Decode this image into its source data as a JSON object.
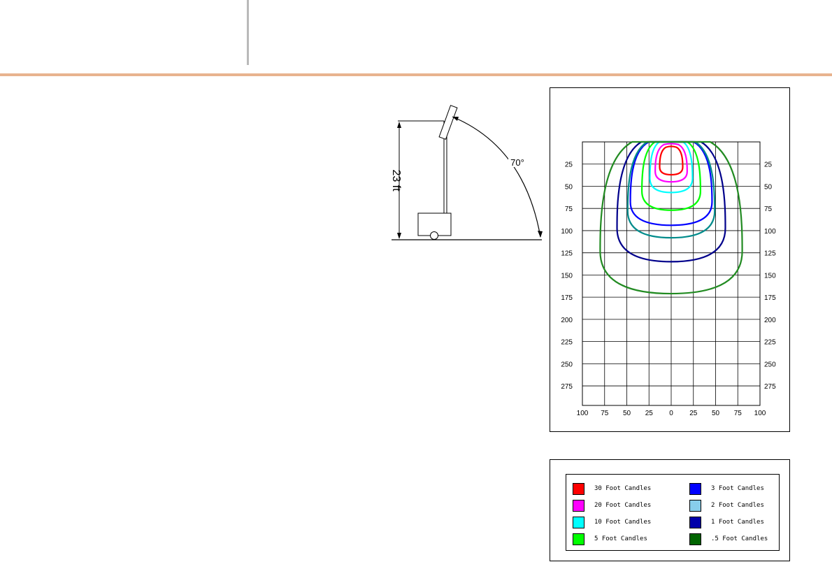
{
  "diagram": {
    "height_label": "23 ft",
    "angle_label": "70°"
  },
  "chart_data": {
    "type": "contour",
    "x_ticks": [
      "100",
      "75",
      "50",
      "25",
      "0",
      "25",
      "50",
      "75",
      "100"
    ],
    "y_ticks": [
      "25",
      "50",
      "75",
      "100",
      "125",
      "150",
      "175",
      "200",
      "225",
      "250",
      "275"
    ],
    "contours": [
      {
        "name": "30 Foot Candles",
        "color": "#ff0000",
        "near": 6,
        "far": 37,
        "half_width": 13
      },
      {
        "name": "20 Foot Candles",
        "color": "#ff00ff",
        "near": 3,
        "far": 45,
        "half_width": 18
      },
      {
        "name": "10 Foot Candles",
        "color": "#00ffff",
        "near": 0,
        "far": 57,
        "half_width": 24
      },
      {
        "name": "5 Foot Candles",
        "color": "#00ff00",
        "near": 0,
        "far": 77,
        "half_width": 33
      },
      {
        "name": "3 Foot Candles",
        "color": "#0000ff",
        "near": 0,
        "far": 94,
        "half_width": 46
      },
      {
        "name": "2 Foot Candles",
        "color": "#008b8b",
        "near": 0,
        "far": 108,
        "half_width": 49
      },
      {
        "name": "1 Foot Candles",
        "color": "#00008b",
        "near": 0,
        "far": 135,
        "half_width": 61
      },
      {
        "name": ".5 Foot Candles",
        "color": "#228b22",
        "near": 0,
        "far": 171,
        "half_width": 80
      }
    ]
  },
  "legend": {
    "items": [
      {
        "label": "30 Foot Candles",
        "color": "#ff0000"
      },
      {
        "label": "3 Foot Candles",
        "color": "#0000ff"
      },
      {
        "label": "20 Foot Candles",
        "color": "#ff00ff"
      },
      {
        "label": "2 Foot Candles",
        "color": "#87ceeb"
      },
      {
        "label": "10 Foot Candles",
        "color": "#00ffff"
      },
      {
        "label": "1 Foot Candles",
        "color": "#0000aa"
      },
      {
        "label": "5 Foot Candles",
        "color": "#00ff00"
      },
      {
        "label": ".5 Foot Candles",
        "color": "#006400"
      }
    ]
  }
}
